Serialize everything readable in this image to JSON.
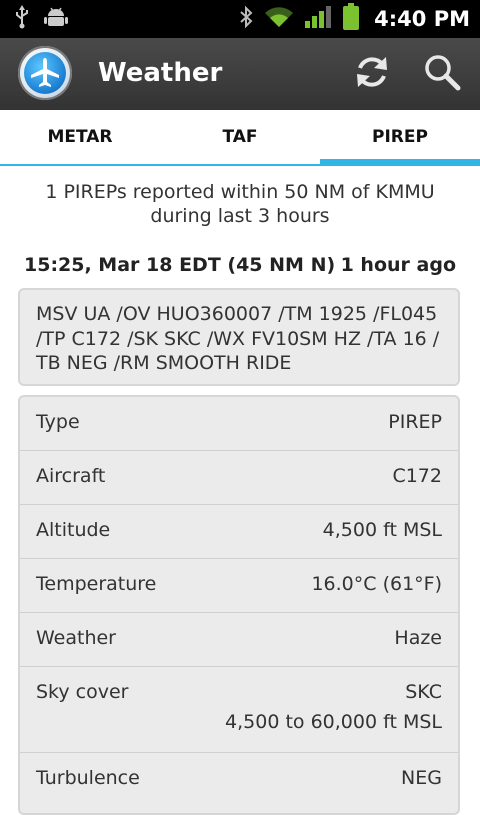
{
  "statusbar": {
    "time": "4:40 PM",
    "icons": [
      "usb-icon",
      "android-debug-icon",
      "bluetooth-icon",
      "wifi-icon",
      "signal-icon",
      "battery-icon"
    ]
  },
  "actionbar": {
    "title": "Weather",
    "logo_icon": "airplane-logo-icon",
    "actions": [
      "refresh-icon",
      "search-icon"
    ]
  },
  "tabs": [
    {
      "label": "METAR",
      "selected": false
    },
    {
      "label": "TAF",
      "selected": false
    },
    {
      "label": "PIREP",
      "selected": true
    }
  ],
  "summary": {
    "line1": "1 PIREPs reported within 50 NM of KMMU",
    "line2": "during last 3 hours"
  },
  "report": {
    "time": "15:25, Mar 18 EDT (45 NM N)",
    "ago": "1 hour ago",
    "raw": "MSV UA /OV HUO360007 /TM 1925 /FL045 /TP C172 /SK SKC /WX FV10SM HZ /TA 16 / TB NEG /RM SMOOTH RIDE"
  },
  "details": [
    {
      "label": "Type",
      "value": "PIREP"
    },
    {
      "label": "Aircraft",
      "value": "C172"
    },
    {
      "label": "Altitude",
      "value": "4,500 ft MSL"
    },
    {
      "label": "Temperature",
      "value": "16.0°C (61°F)"
    },
    {
      "label": "Weather",
      "value": "Haze"
    },
    {
      "label": "Sky cover",
      "value": "SKC",
      "value2": "4,500 to 60,000 ft MSL"
    },
    {
      "label": "Turbulence",
      "value": "NEG"
    }
  ],
  "colors": {
    "accent": "#33b5e5",
    "actionbar": "#3d3d3d",
    "card_bg": "#ebebeb"
  }
}
